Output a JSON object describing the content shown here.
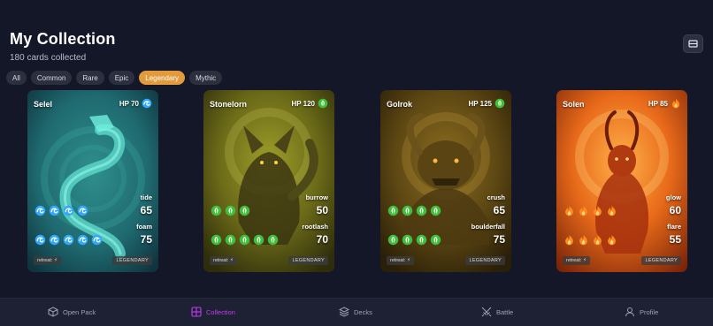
{
  "header": {
    "title": "My Collection",
    "subtitle": "180 cards collected",
    "view_toggle_icon": "layout-icon"
  },
  "filters": [
    {
      "label": "All",
      "active": false
    },
    {
      "label": "Common",
      "active": false
    },
    {
      "label": "Rare",
      "active": false
    },
    {
      "label": "Epic",
      "active": false
    },
    {
      "label": "Legendary",
      "active": true
    },
    {
      "label": "Mythic",
      "active": false
    }
  ],
  "cards": [
    {
      "name": "Selel",
      "hp": "HP 70",
      "element": "water",
      "move1": {
        "name": "tide",
        "damage": "65",
        "cost": 4
      },
      "move2": {
        "name": "foam",
        "damage": "75",
        "cost": 5
      },
      "retreat": "retreat: ⚡",
      "rarity": "LEGENDARY"
    },
    {
      "name": "Stonelorn",
      "hp": "HP 120",
      "element": "grass",
      "move1": {
        "name": "burrow",
        "damage": "50",
        "cost": 3
      },
      "move2": {
        "name": "rootlash",
        "damage": "70",
        "cost": 5
      },
      "retreat": "retreat: ⚡",
      "rarity": "LEGENDARY"
    },
    {
      "name": "Golrok",
      "hp": "HP 125",
      "element": "grass",
      "move1": {
        "name": "crush",
        "damage": "65",
        "cost": 4
      },
      "move2": {
        "name": "boulderfall",
        "damage": "75",
        "cost": 4
      },
      "retreat": "retreat: ⚡",
      "rarity": "LEGENDARY"
    },
    {
      "name": "Solen",
      "hp": "HP 85",
      "element": "fire",
      "move1": {
        "name": "glow",
        "damage": "60",
        "cost": 4
      },
      "move2": {
        "name": "flare",
        "damage": "55",
        "cost": 4
      },
      "retreat": "retreat: ⚡",
      "rarity": "LEGENDARY"
    }
  ],
  "nav": [
    {
      "label": "Open Pack",
      "icon": "package-icon",
      "active": false
    },
    {
      "label": "Collection",
      "icon": "grid-icon",
      "active": true
    },
    {
      "label": "Decks",
      "icon": "layers-icon",
      "active": false
    },
    {
      "label": "Battle",
      "icon": "swords-icon",
      "active": false
    },
    {
      "label": "Profile",
      "icon": "user-icon",
      "active": false
    }
  ],
  "colors": {
    "background": "#141728",
    "accent_filter": "#e39a3c",
    "nav_active": "#c23cf0",
    "water": "#2fa8ff",
    "grass": "#3fbf3a",
    "fire": "#ff8a1e"
  }
}
